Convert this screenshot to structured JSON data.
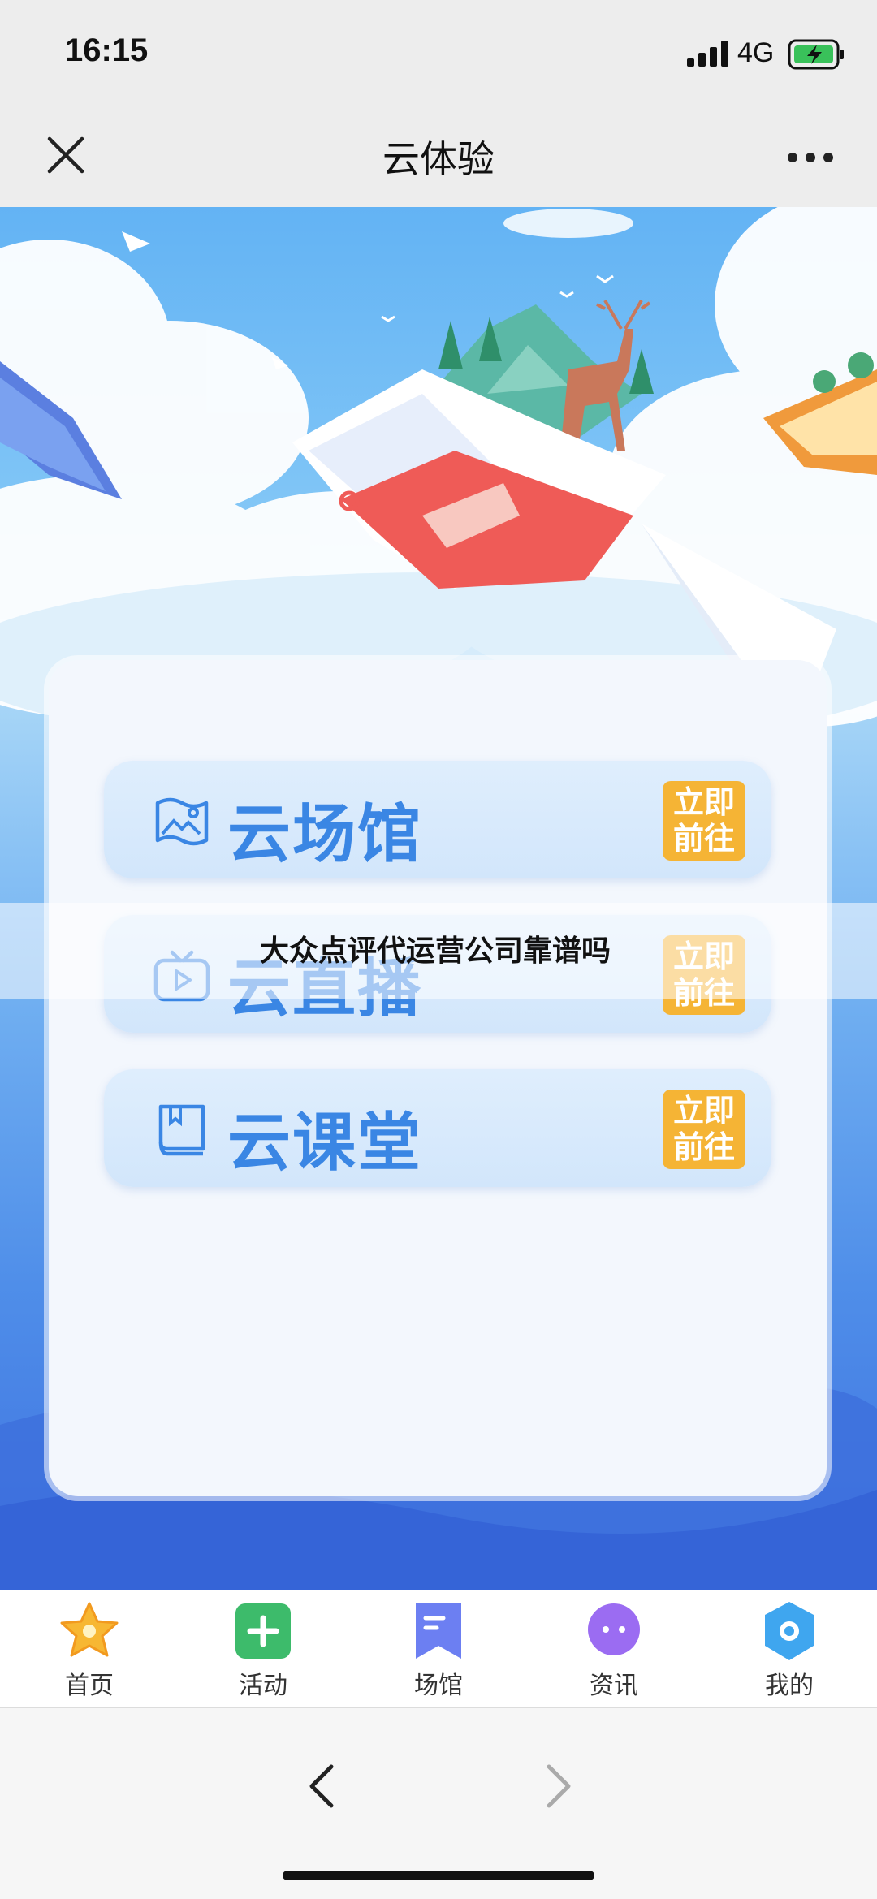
{
  "status_bar": {
    "time": "16:15",
    "network": "4G",
    "icons": [
      "signal-icon",
      "battery-charging-icon"
    ]
  },
  "nav": {
    "title": "云体验",
    "close_icon": "close-icon",
    "more_icon": "more-icon"
  },
  "menu": {
    "items": [
      {
        "label": "云场馆",
        "icon": "museum-map-icon",
        "go_label_line1": "立即",
        "go_label_line2": "前往"
      },
      {
        "label": "云直播",
        "icon": "tv-play-icon",
        "go_label_line1": "立即",
        "go_label_line2": "前往"
      },
      {
        "label": "云课堂",
        "icon": "book-icon",
        "go_label_line1": "立即",
        "go_label_line2": "前往"
      }
    ]
  },
  "overlay": {
    "text": "大众点评代运营公司靠谱吗"
  },
  "tab_bar": {
    "tabs": [
      {
        "label": "首页",
        "icon": "star-icon",
        "color": "#f7b733"
      },
      {
        "label": "活动",
        "icon": "plus-icon",
        "color": "#3dbb6b"
      },
      {
        "label": "场馆",
        "icon": "bookmark-icon",
        "color": "#6c7ff2"
      },
      {
        "label": "资讯",
        "icon": "chat-bubble-icon",
        "color": "#9b6cf2"
      },
      {
        "label": "我的",
        "icon": "profile-circle-icon",
        "color": "#3fa6ef"
      }
    ]
  },
  "colors": {
    "accent_blue": "#3a86e4",
    "go_badge": "#f5b435"
  }
}
